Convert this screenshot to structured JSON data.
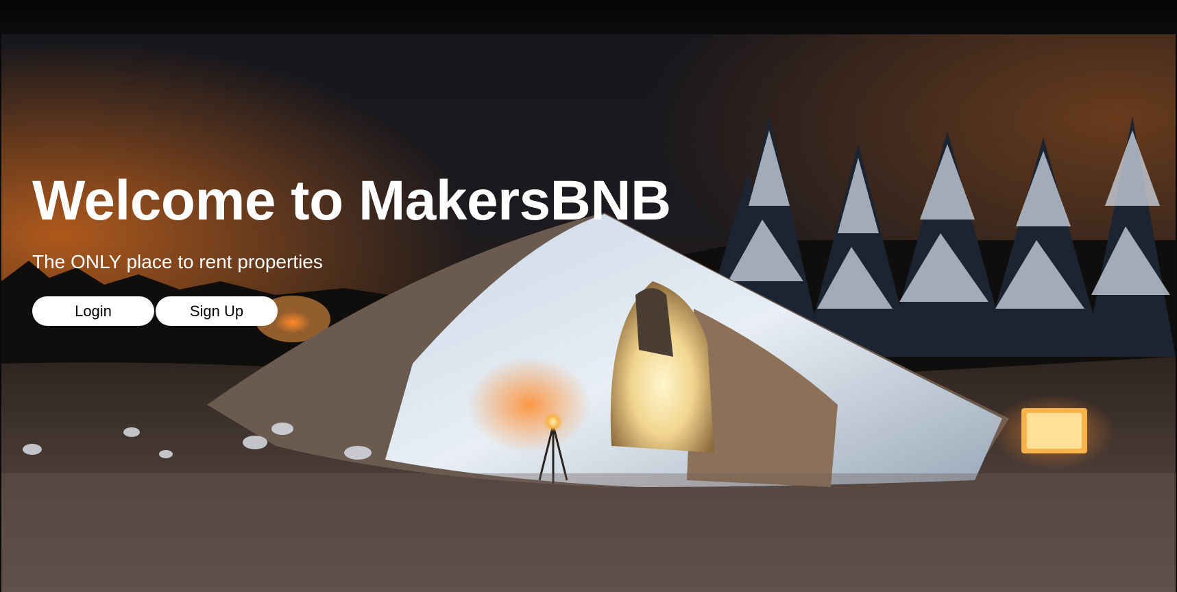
{
  "hero": {
    "title": "Welcome to MakersBNB",
    "tagline": "The ONLY place to rent properties",
    "background_image": "snow-igloo-night-scene"
  },
  "actions": {
    "login_label": "Login",
    "signup_label": "Sign Up"
  },
  "colors": {
    "top_bar": "#0a0a0c",
    "heading_text": "#ffffff",
    "button_bg": "#ffffff",
    "button_text": "#000000"
  }
}
